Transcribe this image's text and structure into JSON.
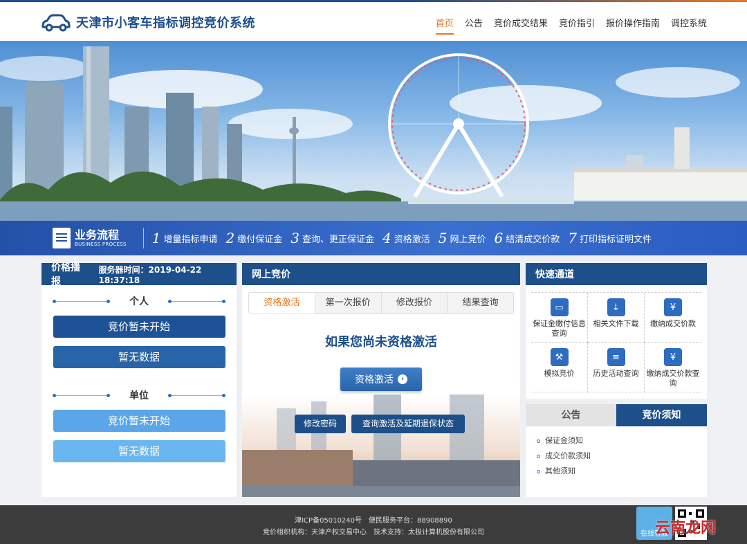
{
  "header": {
    "title": "天津市小客车指标调控竞价系统",
    "nav": [
      {
        "label": "首页",
        "active": true
      },
      {
        "label": "公告",
        "active": false
      },
      {
        "label": "竞价成交结果",
        "active": false
      },
      {
        "label": "竞价指引",
        "active": false
      },
      {
        "label": "报价操作指南",
        "active": false
      },
      {
        "label": "调控系统",
        "active": false
      }
    ]
  },
  "process": {
    "title": "业务流程",
    "subtitle": "BUSINESS PROCESS",
    "steps": [
      {
        "num": "1",
        "label": "增量指标申请"
      },
      {
        "num": "2",
        "label": "缴付保证金"
      },
      {
        "num": "3",
        "label": "查询、更正保证金"
      },
      {
        "num": "4",
        "label": "资格激活"
      },
      {
        "num": "5",
        "label": "网上竞价"
      },
      {
        "num": "6",
        "label": "结清成交价款"
      },
      {
        "num": "7",
        "label": "打印指标证明文件"
      }
    ]
  },
  "price_panel": {
    "title": "价格播报",
    "server_time": "服务器时间：2019-04-22 18:37:18",
    "personal_label": "个人",
    "personal_status": "竞价暂未开始",
    "personal_data": "暂无数据",
    "unit_label": "单位",
    "unit_status": "竞价暂未开始",
    "unit_data": "暂无数据"
  },
  "bid_panel": {
    "title": "网上竞价",
    "tabs": [
      "资格激活",
      "第一次报价",
      "修改报价",
      "结果查询"
    ],
    "heading": "如果您尚未资格激活",
    "activate_button": "资格激活",
    "change_password_button": "修改密码",
    "query_button": "查询激活及延期退保状态"
  },
  "quick_panel": {
    "title": "快速通道",
    "items": [
      {
        "label": "保证金缴付信息查询",
        "icon": "card-icon"
      },
      {
        "label": "相关文件下载",
        "icon": "download-icon"
      },
      {
        "label": "缴纳成交价款",
        "icon": "money-icon"
      },
      {
        "label": "模拟竞价",
        "icon": "gavel-icon"
      },
      {
        "label": "历史活动查询",
        "icon": "list-icon"
      },
      {
        "label": "缴纳成交价款查询",
        "icon": "money-search-icon"
      }
    ]
  },
  "notice_panel": {
    "tab_notice": "公告",
    "tab_rules": "竞价须知",
    "items": [
      "保证金须知",
      "成交价款须知",
      "其他须知"
    ]
  },
  "footer": {
    "line1": "津ICP备05010240号　便民服务平台：88908890",
    "line2": "竞价组织机构：天津产权交易中心　技术支持：太极计算机股份有限公司",
    "online": "在线客服"
  },
  "watermark": "云南龙网",
  "colors": {
    "primary": "#1d4f8a",
    "accent": "#e87722",
    "light_button": "#5aa6e8"
  }
}
